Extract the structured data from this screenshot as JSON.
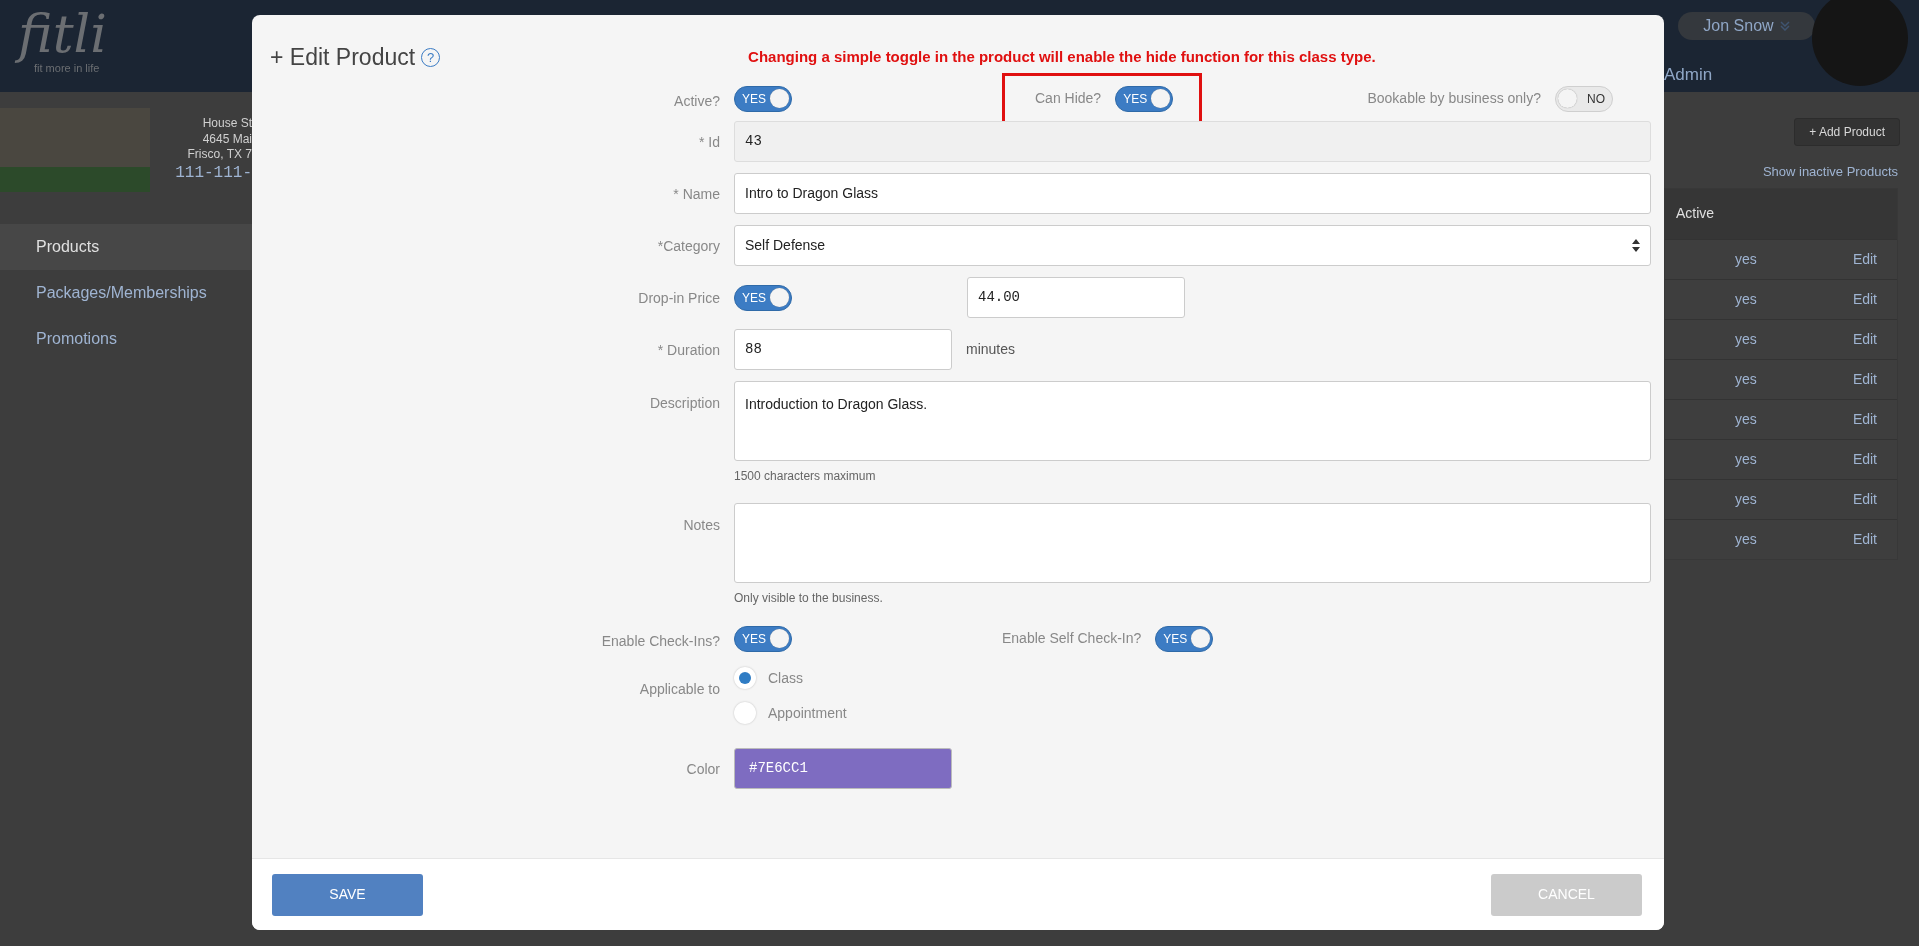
{
  "header": {
    "logo": "fitli",
    "tagline": "fit more in life",
    "user_name": "Jon Snow",
    "role": "Admin"
  },
  "business": {
    "address_lines": [
      "House St",
      "4645 Mai",
      "Frisco, TX 7"
    ],
    "phone": "111-111-"
  },
  "sidebar": {
    "items": [
      {
        "label": "Products",
        "selected": true
      },
      {
        "label": "Packages/Memberships",
        "selected": false
      },
      {
        "label": "Promotions",
        "selected": false
      }
    ]
  },
  "products_panel": {
    "add_button": "+ Add Product",
    "inactive_link": "Show inactive Products",
    "table": {
      "columns": [
        "Active"
      ],
      "rows": [
        {
          "active": "yes",
          "action": "Edit"
        },
        {
          "active": "yes",
          "action": "Edit"
        },
        {
          "active": "yes",
          "action": "Edit"
        },
        {
          "active": "yes",
          "action": "Edit"
        },
        {
          "active": "yes",
          "action": "Edit"
        },
        {
          "active": "yes",
          "action": "Edit"
        },
        {
          "active": "yes",
          "action": "Edit"
        },
        {
          "active": "yes",
          "action": "Edit"
        }
      ]
    }
  },
  "modal": {
    "title": "+ Edit Product",
    "help_icon": "?",
    "warning": "Changing a simple toggle in the product will enable the hide function for this class type.",
    "fields": [
      {
        "kind": "toggles",
        "items": [
          {
            "label": "Active?",
            "on": true,
            "text": "YES"
          },
          {
            "label": "Can Hide?",
            "on": true,
            "text": "YES",
            "highlighted": true
          },
          {
            "label": "Bookable by business only?",
            "on": false,
            "text": "NO"
          }
        ]
      },
      {
        "kind": "readonly",
        "label": "* Id",
        "value": "43"
      },
      {
        "kind": "text",
        "label": "* Name",
        "value": "Intro to Dragon Glass"
      },
      {
        "kind": "select",
        "label": "*Category",
        "value": "Self Defense"
      },
      {
        "kind": "price",
        "label": "Drop-in Price",
        "toggle": {
          "on": true,
          "text": "YES"
        },
        "value": "44.00"
      },
      {
        "kind": "duration",
        "label": "* Duration",
        "value": "88",
        "unit": "minutes"
      },
      {
        "kind": "textarea",
        "label": "Description",
        "value": "Introduction to Dragon Glass.",
        "help": "1500 characters maximum"
      },
      {
        "kind": "textarea",
        "label": "Notes",
        "help": "Only visible to the business."
      },
      {
        "kind": "toggles",
        "items": [
          {
            "label": "Enable Check-Ins?",
            "on": true,
            "text": "YES"
          },
          {
            "label": "Enable Self Check-In?",
            "on": true,
            "text": "YES"
          }
        ]
      },
      {
        "kind": "radio",
        "label": "Applicable to",
        "options": [
          {
            "label": "Class",
            "selected": true
          },
          {
            "label": "Appointment",
            "selected": false
          }
        ]
      },
      {
        "kind": "color",
        "label": "Color",
        "value": "#7E6CC1",
        "color": "#7e6cc1"
      }
    ],
    "save_button": "SAVE",
    "cancel_button": "CANCEL"
  }
}
